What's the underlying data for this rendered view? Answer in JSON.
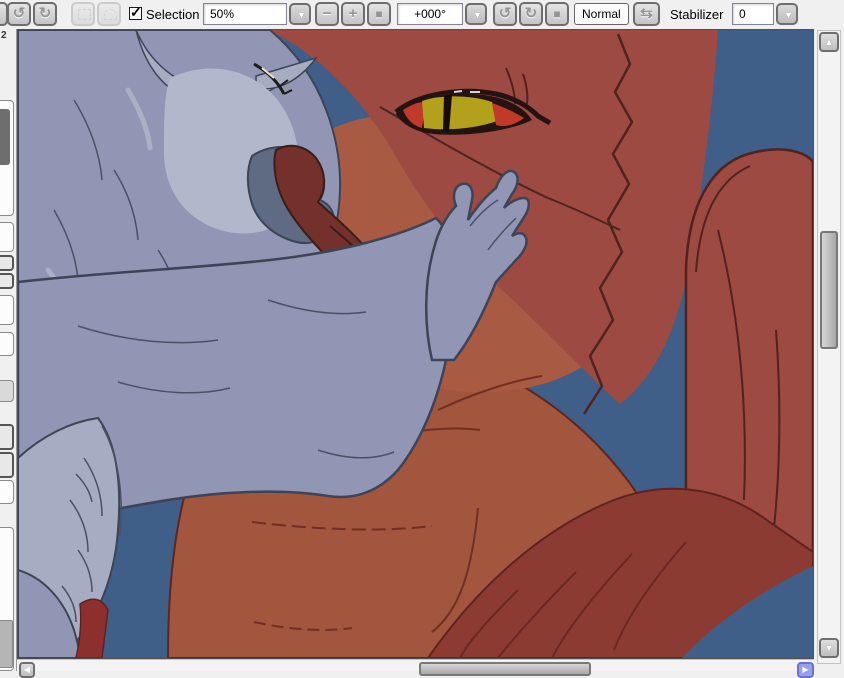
{
  "toolbar": {
    "selection": {
      "label": "Selection",
      "checked": true
    },
    "zoom": {
      "value": "50%"
    },
    "angle": {
      "value": "+000°"
    },
    "blend_mode": {
      "label": "Normal"
    },
    "stabilizer": {
      "label": "Stabilizer",
      "value": "0"
    },
    "glyphs": {
      "undo": "↺",
      "redo": "↻",
      "zoom_out": "−",
      "zoom_in": "+",
      "zoom_reset": "■",
      "rotate_ccw": "↺",
      "rotate_cw": "↻",
      "rotate_reset": "■",
      "flip": "⇆",
      "dropdown": "▼",
      "check": "✓"
    }
  },
  "left_panel": {
    "partial_label": "2"
  },
  "canvas": {
    "palette": {
      "background": "#3f5e88",
      "teal_accent": "#6fa3c0",
      "lavender": "#9096b4",
      "lavender_light": "#b2b8cb",
      "lavender_mid": "#a6acc2",
      "red_dark": "#9c4a42",
      "red_mid": "#a85a43",
      "red_torso": "#a2563d",
      "maroon": "#8c3b33",
      "deep_red": "#8c2f2d",
      "tongue_blue": "#5e6b82",
      "tongue_red": "#74302a",
      "eye_yellow": "#b3a11c",
      "eye_red": "#bf3a2b",
      "eye_outline": "#241310"
    }
  },
  "scrollbars": {
    "glyphs": {
      "up": "▲",
      "down": "▼",
      "left": "◀",
      "right": "▶"
    }
  }
}
